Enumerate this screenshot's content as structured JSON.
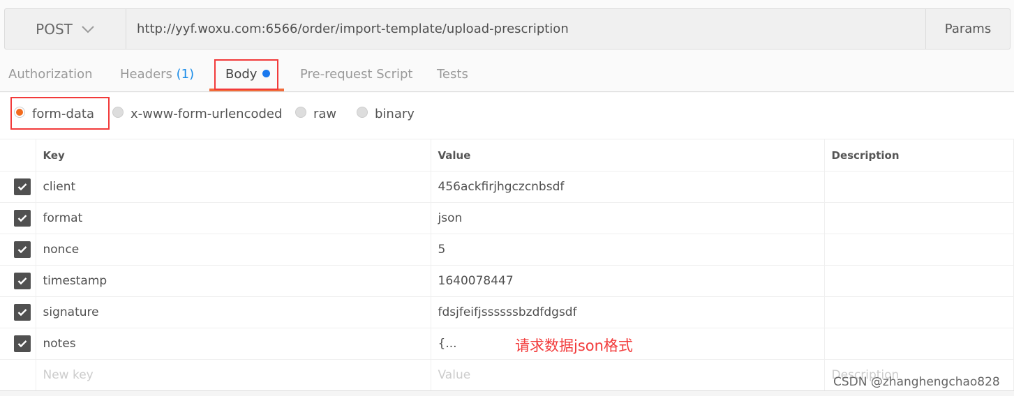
{
  "request": {
    "method": "POST",
    "url": "http://yyf.woxu.com:6566/order/import-template/upload-prescription",
    "params_label": "Params"
  },
  "tabs": [
    {
      "label": "Authorization"
    },
    {
      "label": "Headers",
      "count": "(1)"
    },
    {
      "label": "Body",
      "active": true
    },
    {
      "label": "Pre-request Script"
    },
    {
      "label": "Tests"
    }
  ],
  "body_modes": [
    {
      "label": "form-data",
      "selected": true
    },
    {
      "label": "x-www-form-urlencoded"
    },
    {
      "label": "raw"
    },
    {
      "label": "binary"
    }
  ],
  "table": {
    "headers": [
      "Key",
      "Value",
      "Description"
    ],
    "rows": [
      {
        "checked": true,
        "key": "client",
        "value": "456ackfirjhgczcnbsdf",
        "description": ""
      },
      {
        "checked": true,
        "key": "format",
        "value": "json",
        "description": ""
      },
      {
        "checked": true,
        "key": "nonce",
        "value": "5",
        "description": ""
      },
      {
        "checked": true,
        "key": "timestamp",
        "value": "1640078447",
        "description": ""
      },
      {
        "checked": true,
        "key": "signature",
        "value": "fdsjfeifjssssssbzdfdgsdf",
        "description": ""
      },
      {
        "checked": true,
        "key": "notes",
        "value": "{...",
        "description": ""
      }
    ],
    "new_row": {
      "key_placeholder": "New key",
      "value_placeholder": "Value",
      "description_placeholder": "Description"
    }
  },
  "annotation": "请求数据json格式",
  "watermark": "CSDN @zhanghengchao828",
  "colors": {
    "accent": "#f26b3a",
    "highlight_box": "#f23a3a",
    "dirty_dot": "#1a78ee"
  }
}
